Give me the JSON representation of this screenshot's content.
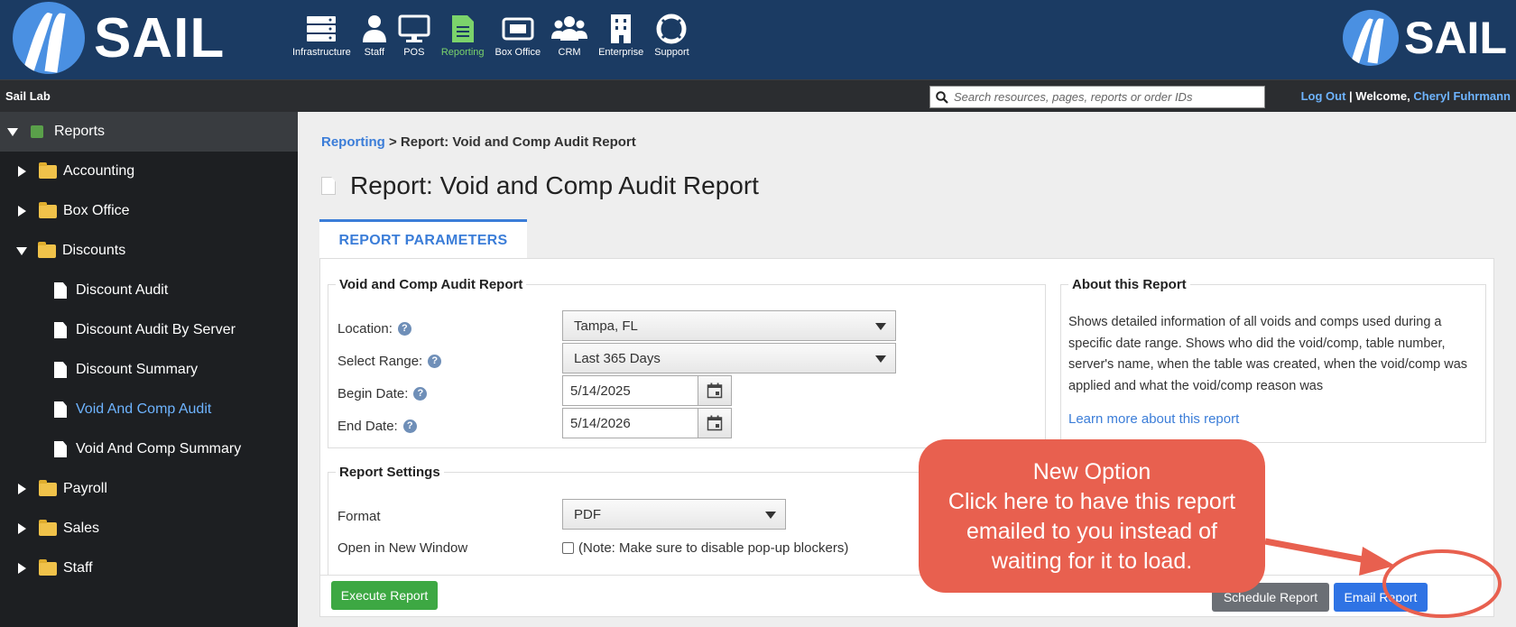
{
  "brand": {
    "logo_text": "SAIL",
    "logo_text_right": "SAIL"
  },
  "modules": [
    {
      "label": "Infrastructure",
      "icon": "server-icon"
    },
    {
      "label": "Staff",
      "icon": "person-icon"
    },
    {
      "label": "POS",
      "icon": "monitor-icon"
    },
    {
      "label": "Reporting",
      "icon": "report-icon",
      "active": true
    },
    {
      "label": "Box Office",
      "icon": "ticket-icon"
    },
    {
      "label": "CRM",
      "icon": "users-icon"
    },
    {
      "label": "Enterprise",
      "icon": "building-icon"
    },
    {
      "label": "Support",
      "icon": "lifebuoy-icon"
    }
  ],
  "subbar": {
    "site_name": "Sail Lab",
    "search_placeholder": "Search resources, pages, reports or order IDs",
    "logout": "Log Out",
    "separator": "|",
    "welcome": "Welcome,",
    "user_name": "Cheryl Fuhrmann"
  },
  "sidebar": {
    "root": "Reports",
    "folders": {
      "accounting": "Accounting",
      "box_office": "Box Office",
      "discounts": "Discounts",
      "payroll": "Payroll",
      "sales": "Sales",
      "staff": "Staff"
    },
    "discount_items": [
      "Discount Audit",
      "Discount Audit By Server",
      "Discount Summary",
      "Void And Comp Audit",
      "Void And Comp Summary"
    ],
    "selected": "Void And Comp Audit"
  },
  "breadcrumb": {
    "link": "Reporting",
    "current": "> Report: Void and Comp Audit Report"
  },
  "page_title": "Report: Void and Comp Audit Report",
  "tab": "REPORT PARAMETERS",
  "params": {
    "legend": "Void and Comp Audit Report",
    "location_label": "Location:",
    "location_value": "Tampa, FL",
    "range_label": "Select Range:",
    "range_value": "Last 365 Days",
    "begin_label": "Begin Date:",
    "begin_value": "5/14/2025",
    "end_label": "End Date:",
    "end_value": "5/14/2026"
  },
  "settings": {
    "legend": "Report Settings",
    "format_label": "Format",
    "format_value": "PDF",
    "newwindow_label": "Open in New Window",
    "newwindow_note": "(Note: Make sure to disable pop-up blockers)"
  },
  "about": {
    "legend": "About this Report",
    "text": "Shows detailed information of all voids and comps used during a specific date range. Shows who did the void/comp, table number, server's name, when the table was created, when the void/comp was applied and what the void/comp reason was",
    "link": "Learn more about this report"
  },
  "buttons": {
    "execute": "Execute Report",
    "schedule": "Schedule Report",
    "email": "Email Report"
  },
  "callout": {
    "lines": [
      "New Option",
      "Click here to have this report",
      "emailed to you instead of",
      "waiting for it to load."
    ]
  },
  "colors": {
    "header": "#1b3b63",
    "accent": "#3b7dd8",
    "callout": "#e8604f",
    "execute": "#3da843",
    "email": "#2f73e4"
  }
}
